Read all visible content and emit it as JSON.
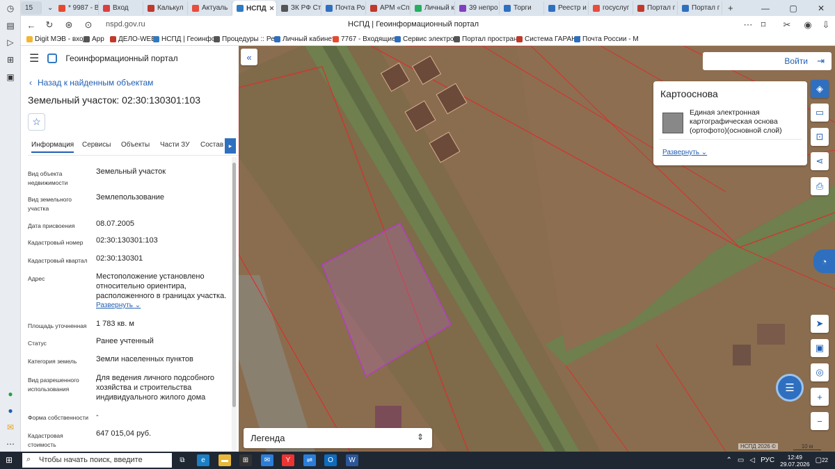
{
  "browser": {
    "tab_count": "15",
    "tabs": [
      {
        "label": "* 9987 - В",
        "color": "#e64a2e"
      },
      {
        "label": "Вход",
        "color": "#d94040"
      },
      {
        "label": "Калькул",
        "color": "#c0392b"
      },
      {
        "label": "Актуаль",
        "color": "#e74c3c"
      },
      {
        "label": "НСПД",
        "color": "#2f7ac4"
      },
      {
        "label": "ЗК РФ Ст",
        "color": "#555555"
      },
      {
        "label": "Почта Ро",
        "color": "#2f6fbf"
      },
      {
        "label": "АРМ «Сп",
        "color": "#c0392b"
      },
      {
        "label": "Личный к",
        "color": "#27ae60"
      },
      {
        "label": "39 непро",
        "color": "#7f3fbf"
      },
      {
        "label": "Торги",
        "color": "#2f6fbf"
      },
      {
        "label": "Реестр и",
        "color": "#2f6fbf"
      },
      {
        "label": "госуслуг",
        "color": "#e74c3c"
      },
      {
        "label": "Портал г",
        "color": "#c0392b"
      },
      {
        "label": "Портал г",
        "color": "#2f6fbf"
      }
    ],
    "url": "nspd.gov.ru",
    "page_title": "НСПД | Геоинформационный портал",
    "bookmarks": [
      "Digit МЭВ - вход",
      "App",
      "ДЕЛО-WEB",
      "НСПД | Геоинфор",
      "Процедуры :: Реа",
      "Личный кабинет",
      "7767 - Входящие",
      "Сервис электрон",
      "Портал простран",
      "Система ГАРАНТ",
      "Почта России - М"
    ]
  },
  "portal": {
    "name": "Геоинформационный портал",
    "back_link": "Назад к найденным объектам",
    "object_title": "Земельный участок: 02:30:130301:103",
    "tabs": [
      "Информация",
      "Сервисы",
      "Объекты",
      "Части ЗУ",
      "Состав"
    ],
    "fields": [
      {
        "label": "Вид объекта недвижимости",
        "value": "Земельный участок"
      },
      {
        "label": "Вид земельного участка",
        "value": "Землепользование"
      },
      {
        "label": "Дата присвоения",
        "value": "08.07.2005"
      },
      {
        "label": "Кадастровый номер",
        "value": "02:30:130301:103"
      },
      {
        "label": "Кадастровый квартал",
        "value": "02:30:130301"
      },
      {
        "label": "Адрес",
        "value": "Местоположение установлено относительно ориентира, расположенного в границах участка."
      },
      {
        "label": "Площадь уточненная",
        "value": "1 783 кв. м"
      },
      {
        "label": "Статус",
        "value": "Ранее учтенный"
      },
      {
        "label": "Категория земель",
        "value": "Земли населенных пунктов"
      },
      {
        "label": "Вид разрешенного использования",
        "value": "Для ведения личного подсобного хозяйства и строительства индивидуального жилого дома"
      },
      {
        "label": "Форма собственности",
        "value": "-"
      },
      {
        "label": "Кадастровая стоимость",
        "value": "647 015,04 руб."
      }
    ],
    "expand_label": "Развернуть"
  },
  "map": {
    "login_label": "Войти",
    "basemap": {
      "title": "Картооснова",
      "layer": "Единая электронная картографическая основа (ортофото)(основной слой)",
      "expand": "Развернуть"
    },
    "legend_label": "Легенда",
    "copyright": "НСПД 2026 ©",
    "scale": "10 м",
    "colors": {
      "ground": "#8a6d4e",
      "strip": "#6f7f4e",
      "parcel": "#b06ab0",
      "boundary": "#d8302f"
    }
  },
  "taskbar": {
    "search_placeholder": "Чтобы начать поиск, введите",
    "language": "РУС",
    "time": "12:49",
    "date": "29.07.2026",
    "notifications": "22"
  }
}
